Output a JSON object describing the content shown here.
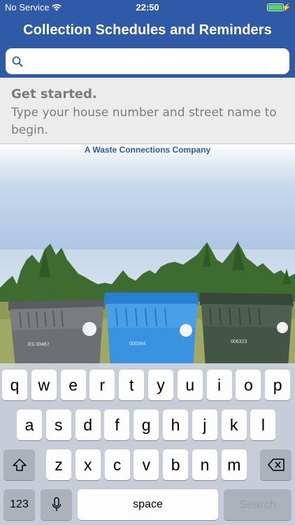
{
  "status_bar": {
    "carrier": "No Service",
    "time": "22:50",
    "battery_level": 1.0,
    "icons": [
      "wifi-icon",
      "battery-icon",
      "charging-bolt-icon"
    ]
  },
  "header": {
    "title": "Collection Schedules and Reminders"
  },
  "search": {
    "placeholder": "",
    "value": "",
    "icon": "search-icon"
  },
  "info": {
    "heading": "Get started.",
    "text": "Type your house number and street name to begin."
  },
  "hero": {
    "tagline": "A Waste Connections Company",
    "bin_numbers": [
      "ES 00467",
      "000364",
      "006323"
    ]
  },
  "keyboard": {
    "row1": [
      "q",
      "w",
      "e",
      "r",
      "t",
      "y",
      "u",
      "i",
      "o",
      "p"
    ],
    "row2": [
      "a",
      "s",
      "d",
      "f",
      "g",
      "h",
      "j",
      "k",
      "l"
    ],
    "row3": [
      "z",
      "x",
      "c",
      "v",
      "b",
      "n",
      "m"
    ],
    "numbers_label": "123",
    "space_label": "space",
    "search_label": "Search",
    "icons": [
      "shift-icon",
      "backspace-icon",
      "microphone-icon"
    ]
  },
  "colors": {
    "brand_blue": "#2f5aa8",
    "battery_green": "#4cd964"
  }
}
